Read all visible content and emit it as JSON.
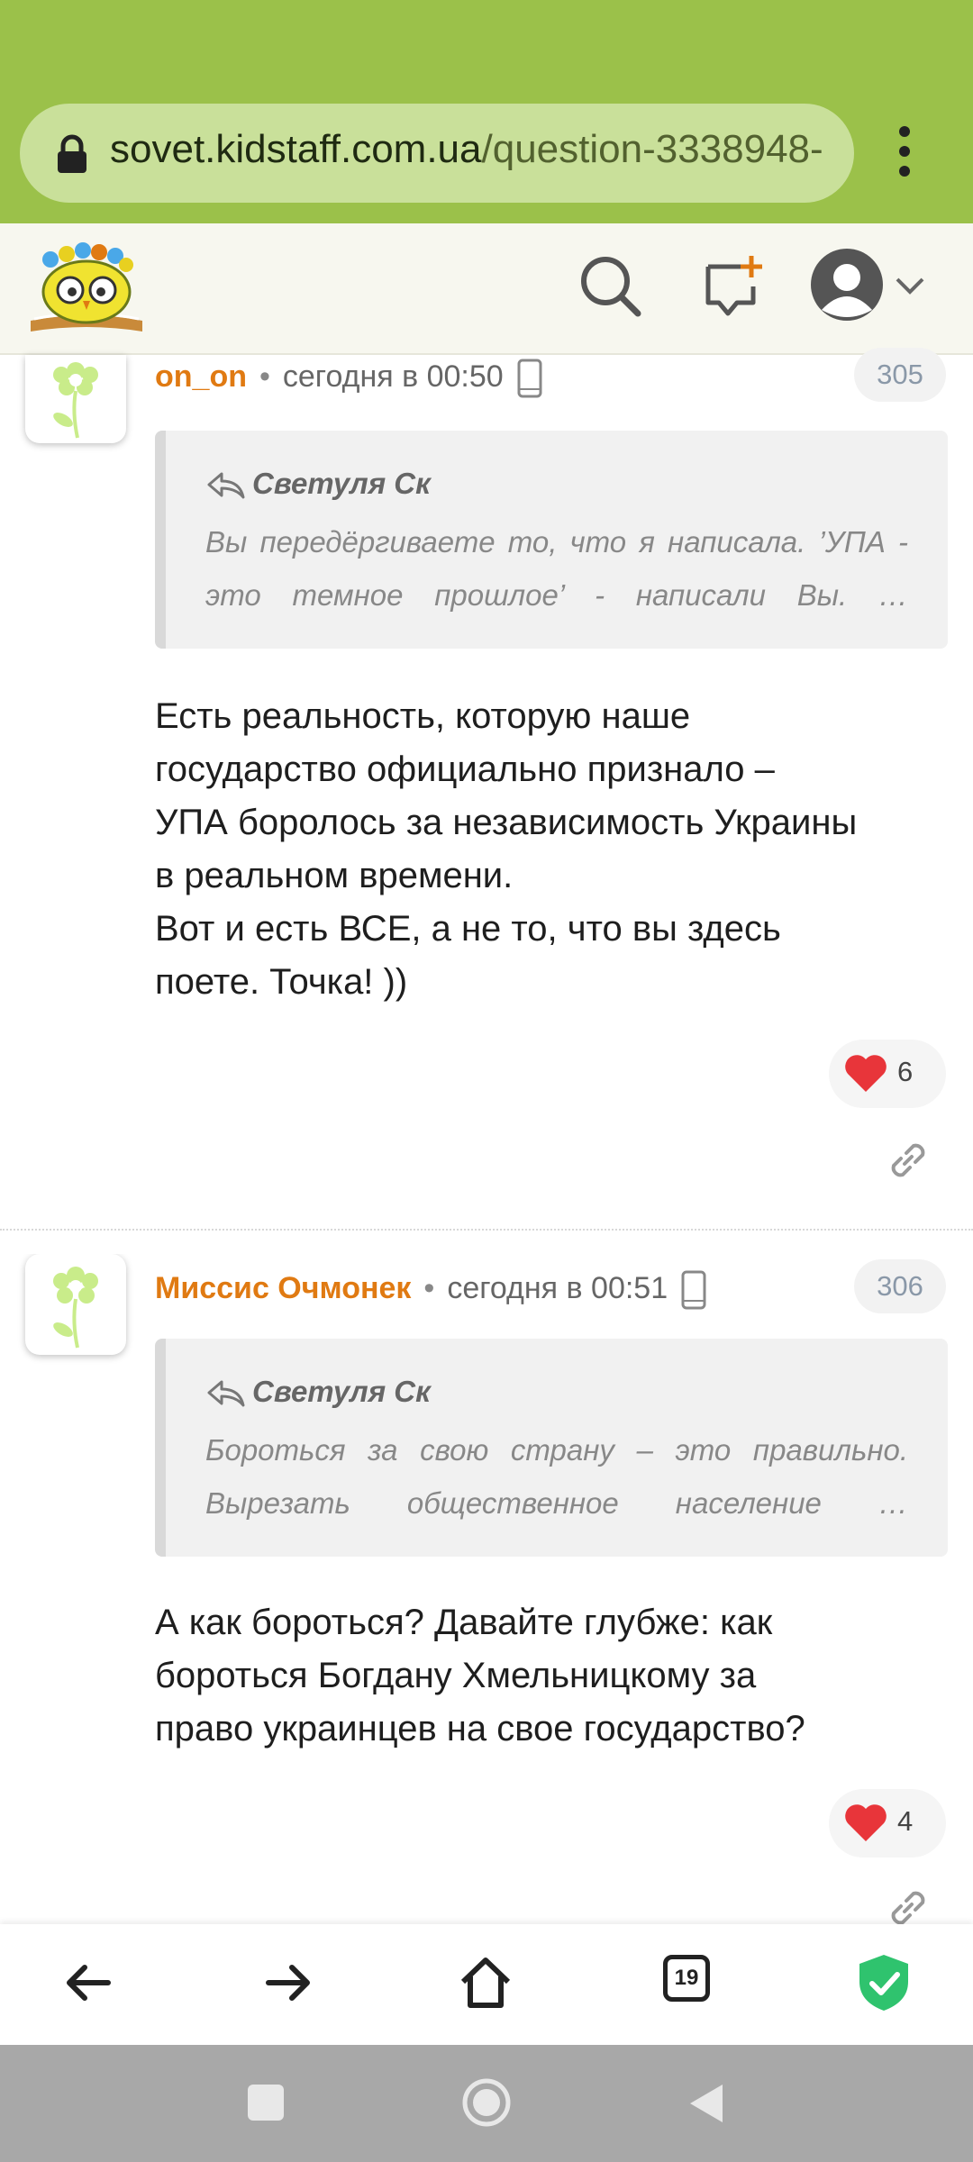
{
  "browser": {
    "url_host": "sovet.kidstaff.com.ua",
    "url_path": "/question-3338948-",
    "tabs_count": "19"
  },
  "site": {
    "icons": [
      "logo-owl-icon",
      "search-icon",
      "new-message-icon",
      "user-avatar-icon",
      "chevron-down-icon"
    ]
  },
  "posts": [
    {
      "author": "on_on",
      "time": "сегодня в 00:50",
      "number": "305",
      "quote_author": "Светуля Ск",
      "quote_text": "Вы передёргиваете то, что я написала. ’УПА - это темное прошлое’ - написали Вы. …",
      "body_lines": [
        "Есть реальность, которую наше",
        "государство официально признало –",
        "УПА боролось за независимость Украины",
        "в реальном времени.",
        "Вот и есть ВСЕ, а не то, что вы здесь",
        "поете. Точка! ))"
      ],
      "likes": "6"
    },
    {
      "author": "Миссис Очмонек",
      "time": "сегодня в 00:51",
      "number": "306",
      "quote_author": "Светуля Ск",
      "quote_text": "Бороться за свою страну – это правильно. Вырезать общественное население …",
      "body_lines": [
        "А как бороться? Давайте глубже: как",
        "бороться Богдану Хмельницкому за",
        "право украинцев на свое государство?"
      ],
      "likes": "4"
    }
  ],
  "colors": {
    "chrome_green": "#9bc14a",
    "author_orange": "#e07a12",
    "shield_green": "#2fc36e"
  }
}
